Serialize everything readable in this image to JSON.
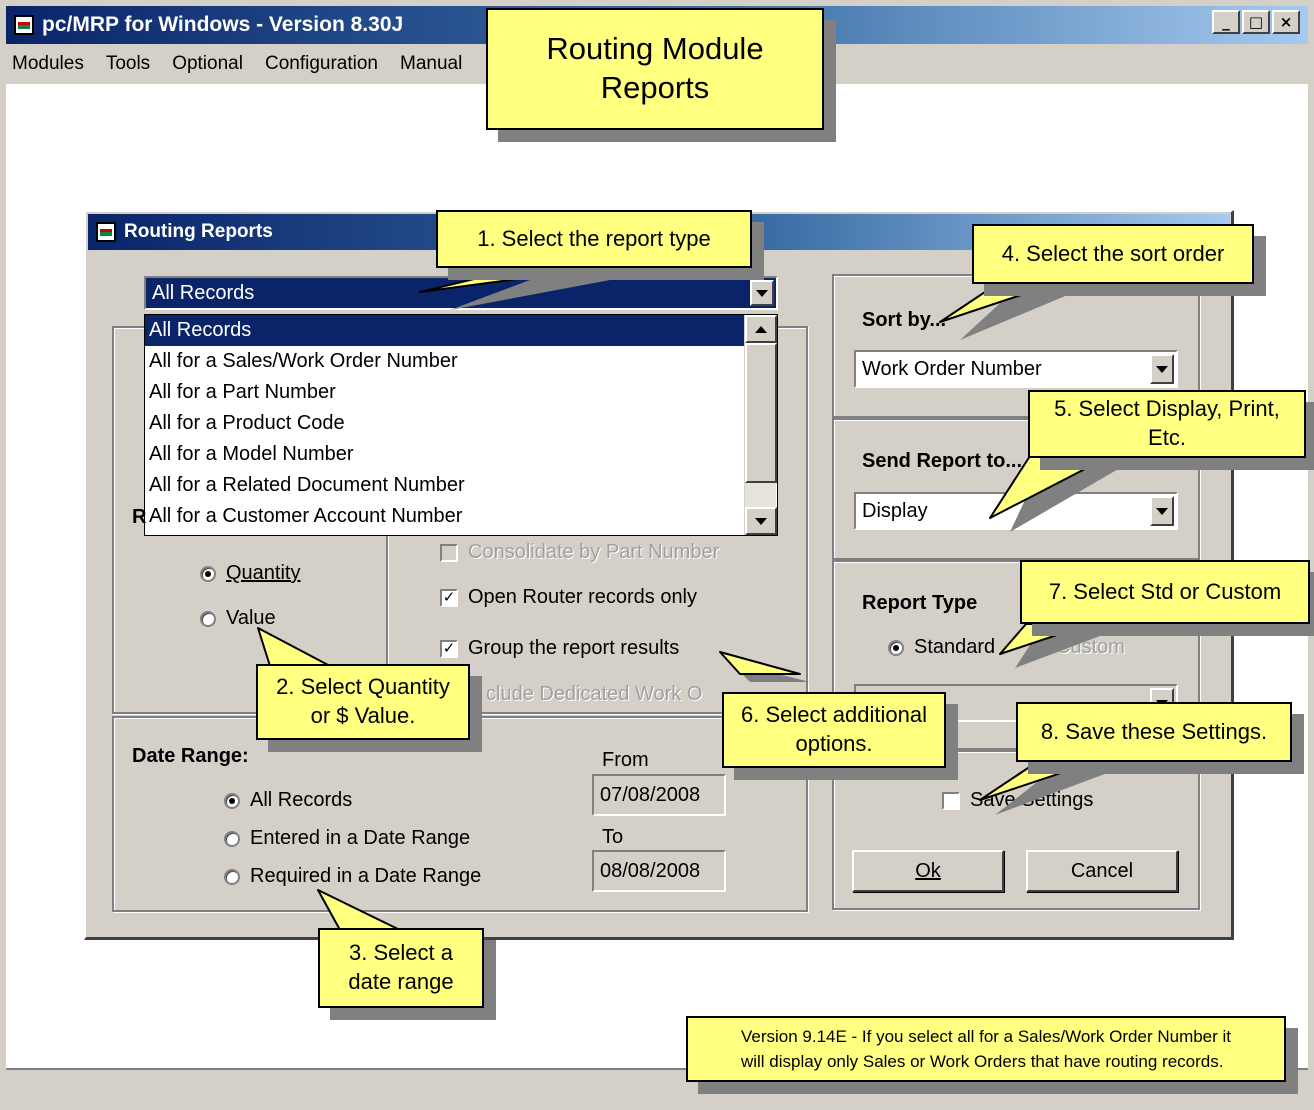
{
  "window": {
    "title": "pc/MRP for Windows - Version 8.30J",
    "controls": [
      "_",
      "□",
      "×"
    ]
  },
  "menu": [
    "Modules",
    "Tools",
    "Optional",
    "Configuration",
    "Manual"
  ],
  "dialog": {
    "title": "Routing Reports",
    "selection": {
      "value": "All Records",
      "options": [
        "All Records",
        "All for a Sales/Work Order Number",
        "All for a Part Number",
        "All for a Product Code",
        "All for a Model Number",
        "All for a Related Document Number",
        "All for a Customer Account Number"
      ]
    },
    "report_by": {
      "label_fragment": "R",
      "options": [
        {
          "label": "Quantity",
          "selected": true
        },
        {
          "label": "Value",
          "selected": false
        }
      ]
    },
    "checkboxes": [
      {
        "label": "Consolidate by Part Number",
        "checked": false,
        "enabled": false
      },
      {
        "label": "Open Router records only",
        "checked": true,
        "enabled": true
      },
      {
        "label": "Group the report results",
        "checked": true,
        "enabled": true
      },
      {
        "label": "clude Dedicated Work O",
        "checked": false,
        "enabled": false
      }
    ],
    "date_range": {
      "label": "Date Range:",
      "options": [
        {
          "label": "All Records",
          "selected": true
        },
        {
          "label": "Entered in a Date Range",
          "selected": false
        },
        {
          "label": "Required in a  Date Range",
          "selected": false
        }
      ],
      "from_label": "From",
      "from_value": "07/08/2008",
      "to_label": "To",
      "to_value": "08/08/2008"
    },
    "sort_by": {
      "label": "Sort by...",
      "value": "Work Order Number"
    },
    "send_to": {
      "label": "Send Report to...",
      "value": "Display"
    },
    "report_type": {
      "label": "Report Type",
      "options": [
        {
          "label": "Standard",
          "selected": true,
          "enabled": true
        },
        {
          "label": "Custom",
          "selected": false,
          "enabled": false
        }
      ]
    },
    "save_settings": {
      "label": "Save Settings",
      "checked": false
    },
    "ok_label": "Ok",
    "cancel_label": "Cancel"
  },
  "callouts": {
    "title": "Routing Module\nReports",
    "c1": "1. Select the report type",
    "c2": "2. Select Quantity\nor $ Value.",
    "c3": "3. Select a\ndate range",
    "c4": "4. Select the sort order",
    "c5": "5. Select Display, Print,\nEtc.",
    "c6": "6. Select additional\noptions.",
    "c7": "7. Select Std or Custom",
    "c8": "8. Save these Settings.",
    "note": "Version 9.14E - If you select all for a Sales/Work Order Number it\nwill display only Sales or Work Orders that have routing records."
  },
  "colors": {
    "titlebar_start": "#0a246a",
    "titlebar_end": "#a6caf0",
    "window_face": "#d4d0c8",
    "callout_fill": "#ffff80",
    "selection": "#0a246a"
  },
  "icons": [
    "app-icon",
    "minimize-icon",
    "maximize-icon",
    "close-icon",
    "dropdown-arrow-icon",
    "scroll-up-arrow-icon",
    "scroll-down-arrow-icon"
  ]
}
